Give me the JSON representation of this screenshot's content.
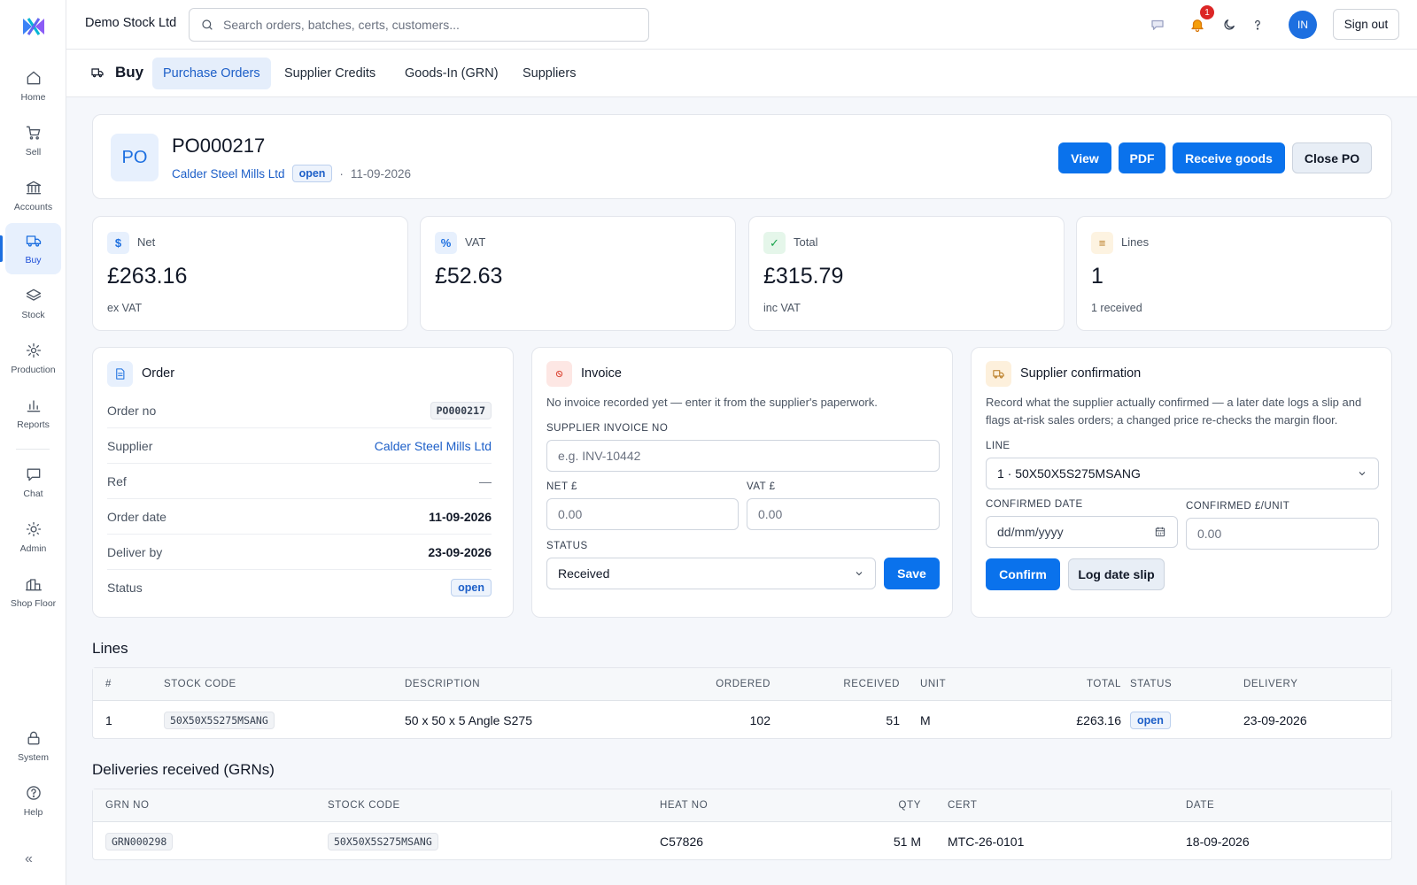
{
  "app": {
    "company": "Demo Stock Ltd",
    "search_placeholder": "Search orders, batches, certs, customers...",
    "notifications_count": "1",
    "avatar_initials": "IN",
    "signout_label": "Sign out"
  },
  "sidebar": {
    "items": [
      {
        "label": "Home",
        "icon": "home-icon"
      },
      {
        "label": "Sell",
        "icon": "cart-icon"
      },
      {
        "label": "Accounts",
        "icon": "bank-icon"
      },
      {
        "label": "Buy",
        "icon": "truck-icon"
      },
      {
        "label": "Stock",
        "icon": "layers-icon"
      },
      {
        "label": "Production",
        "icon": "gear-icon"
      },
      {
        "label": "Reports",
        "icon": "bar-chart-icon"
      },
      {
        "label": "Chat",
        "icon": "chat-icon"
      },
      {
        "label": "Admin",
        "icon": "sun-icon"
      },
      {
        "label": "Shop Floor",
        "icon": "factory-icon"
      },
      {
        "label": "System",
        "icon": "lock-icon"
      },
      {
        "label": "Help",
        "icon": "help-icon"
      }
    ],
    "active": "Buy",
    "collapse_label": "«"
  },
  "subnav": {
    "section": "Buy",
    "tabs": [
      "Purchase Orders",
      "Supplier Credits",
      "Goods-In (GRN)",
      "Suppliers"
    ],
    "active_tab": "Purchase Orders"
  },
  "po": {
    "badge": "PO",
    "number": "PO000217",
    "supplier": "Calder Steel Mills Ltd",
    "status": "open",
    "separator": "·",
    "date": "11-09-2026",
    "actions": {
      "view": "View",
      "pdf": "PDF",
      "receive": "Receive goods",
      "close": "Close PO"
    }
  },
  "stats": [
    {
      "icon": "dollar-icon",
      "glyph": "$",
      "label": "Net",
      "value": "£263.16",
      "sub": "ex VAT",
      "color": "#1d6fe0",
      "bg": "#e7f0fd"
    },
    {
      "icon": "percent-icon",
      "glyph": "%",
      "label": "VAT",
      "value": "£52.63",
      "sub": "",
      "color": "#1d6fe0",
      "bg": "#e7f0fd"
    },
    {
      "icon": "check-icon",
      "glyph": "✓",
      "label": "Total",
      "value": "£315.79",
      "sub": "inc VAT",
      "color": "#16a34a",
      "bg": "#e5f6ea"
    },
    {
      "icon": "list-icon",
      "glyph": "≡",
      "label": "Lines",
      "value": "1",
      "sub": "1 received",
      "color": "#b7791f",
      "bg": "#fdf3e1"
    }
  ],
  "order": {
    "title": "Order",
    "rows": [
      {
        "label": "Order no",
        "value": "PO000217"
      },
      {
        "label": "Supplier",
        "value": "Calder Steel Mills Ltd"
      },
      {
        "label": "Ref",
        "value": "—"
      },
      {
        "label": "Order date",
        "value": "11-09-2026"
      },
      {
        "label": "Deliver by",
        "value": "23-09-2026"
      },
      {
        "label": "Status",
        "value": "open"
      }
    ]
  },
  "invoice": {
    "title": "Invoice",
    "help": "No invoice recorded yet — enter it from the supplier's paperwork.",
    "supplier_invoice_label": "SUPPLIER INVOICE NO",
    "supplier_invoice_placeholder": "e.g. INV-10442",
    "net_label": "NET £",
    "net_placeholder": "0.00",
    "vat_label": "VAT £",
    "vat_placeholder": "0.00",
    "status_label": "STATUS",
    "status_value": "Received",
    "save_label": "Save"
  },
  "confirmation": {
    "title": "Supplier confirmation",
    "help_line1": "Record what the supplier actually confirmed — a later date logs a slip and",
    "help_line2": "flags at-risk sales orders; a changed price re-checks the margin floor.",
    "line_label": "LINE",
    "line_value": "1 · 50X50X5S275MSANG",
    "date_label": "CONFIRMED DATE",
    "date_placeholder": "dd/mm/yyyy",
    "unit_label": "CONFIRMED £/UNIT",
    "unit_placeholder": "0.00",
    "confirm_label": "Confirm",
    "slip_label": "Log date slip"
  },
  "lines": {
    "title": "Lines",
    "headers": [
      "#",
      "STOCK CODE",
      "DESCRIPTION",
      "ORDERED",
      "RECEIVED",
      "UNIT",
      "TOTAL",
      "STATUS",
      "DELIVERY"
    ],
    "rows": [
      {
        "num": "1",
        "code": "50X50X5S275MSANG",
        "description": "50 x 50 x 5 Angle S275",
        "ordered": "102",
        "received": "51",
        "unit": "M",
        "total": "£263.16",
        "status": "open",
        "delivery": "23-09-2026"
      }
    ]
  },
  "grns": {
    "title": "Deliveries received (GRNs)",
    "headers": [
      "GRN NO",
      "STOCK CODE",
      "HEAT NO",
      "QTY",
      "CERT",
      "DATE"
    ],
    "rows": [
      {
        "grn": "GRN000298",
        "code": "50X50X5S275MSANG",
        "heat": "C57826",
        "qty": "51 M",
        "cert": "MTC-26-0101",
        "date": "18-09-2026"
      }
    ]
  }
}
